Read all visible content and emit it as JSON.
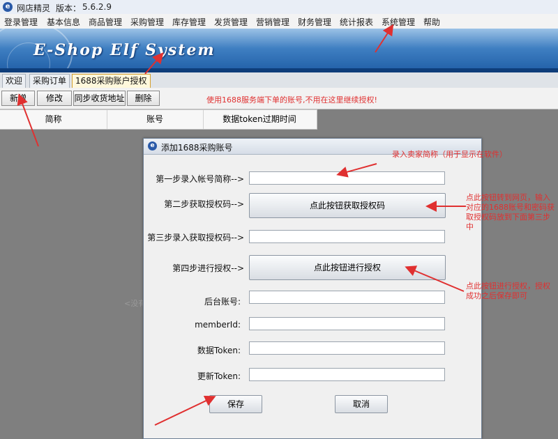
{
  "window": {
    "title": "网店精灵",
    "version_label": "版本：",
    "version": "5.6.2.9"
  },
  "menu": [
    "登录管理",
    "基本信息",
    "商品管理",
    "采购管理",
    "库存管理",
    "发货管理",
    "营销管理",
    "财务管理",
    "统计报表",
    "系统管理",
    "帮助"
  ],
  "banner": {
    "logo_text": "E-Shop Elf System"
  },
  "tabs": [
    {
      "label": "欢迎"
    },
    {
      "label": "采购订单"
    },
    {
      "label": "1688采购账户授权",
      "active": true
    }
  ],
  "toolbar": {
    "buttons": [
      "新增",
      "修改",
      "同步收货地址",
      "删除"
    ],
    "notice": "使用1688服务端下单的账号,不用在这里继续授权!"
  },
  "grid": {
    "columns": [
      "简称",
      "账号",
      "数据token过期时间"
    ]
  },
  "background_hint": "<没有",
  "dialog": {
    "title": "添加1688采购账号",
    "step1_label": "第一步录入帐号简称-->",
    "step2_label": "第二步获取授权码-->",
    "step2_button": "点此按钮获取授权码",
    "step3_label": "第三步录入获取授权码-->",
    "step4_label": "第四步进行授权-->",
    "step4_button": "点此按钮进行授权",
    "backend_account_label": "后台账号:",
    "member_id_label": "memberId:",
    "data_token_label": "数据Token:",
    "refresh_token_label": "更新Token:",
    "save_button": "保存",
    "cancel_button": "取消"
  },
  "annotations": {
    "seller_name": "录入卖家简称（用于显示在软件）",
    "get_code": "点此按钮转到网页，输入对应的1688账号和密码获取授权码放到下面第三步中",
    "authorize": "点此按钮进行授权，授权成功之后保存即可"
  },
  "colors": {
    "annotation_red": "#e03030",
    "active_tab": "#fff8dc",
    "banner_blue": "#1f5ea6"
  }
}
